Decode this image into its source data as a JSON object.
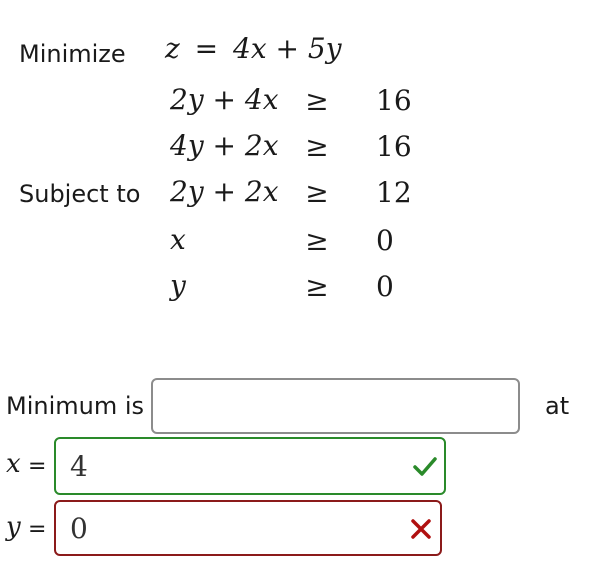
{
  "problem": {
    "minimize_label": "Minimize",
    "objective": {
      "lhs": "z",
      "eq": "=",
      "rhs": "4x + 5y"
    },
    "subject_to_label": "Subject to",
    "constraints": [
      {
        "lhs": "2y + 4x",
        "rel": "≥",
        "rhs": "16"
      },
      {
        "lhs": "4y + 2x",
        "rel": "≥",
        "rhs": "16"
      },
      {
        "lhs": "2y + 2x",
        "rel": "≥",
        "rhs": "12"
      },
      {
        "lhs": "x",
        "rel": "≥",
        "rhs": "0"
      },
      {
        "lhs": "y",
        "rel": "≥",
        "rhs": "0"
      }
    ]
  },
  "answer": {
    "minimum_label": "Minimum is",
    "minimum_value": "",
    "at_label": "at",
    "x_label": "x",
    "x_eq": "=",
    "x_value": "4",
    "x_status": "correct",
    "y_label": "y",
    "y_eq": "=",
    "y_value": "0",
    "y_status": "incorrect"
  },
  "colors": {
    "correct": "#2a8a2a",
    "incorrect": "#8b1a1a",
    "neutral_border": "#8c8c8c"
  }
}
